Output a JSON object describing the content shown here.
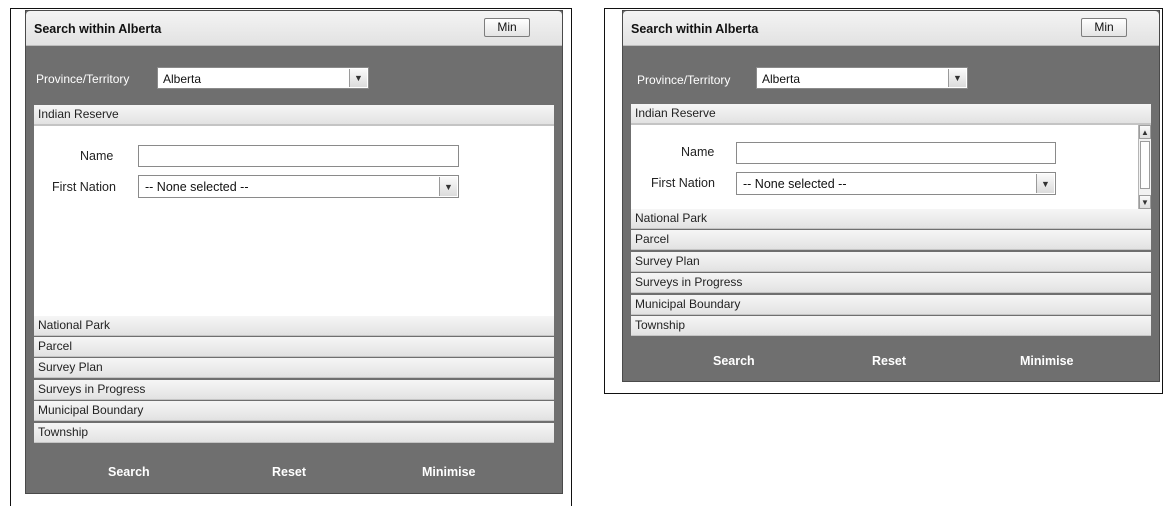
{
  "expanded_view": {
    "title": "Search within Alberta",
    "min_label": "Min",
    "province_label": "Province/Territory",
    "province_value": "Alberta",
    "sections": {
      "indian_reserve": "Indian Reserve",
      "national_park": "National Park",
      "parcel": "Parcel",
      "survey_plan": "Survey Plan",
      "surveys_in_progress": "Surveys in Progress",
      "municipal_boundary": "Municipal Boundary",
      "township": "Township"
    },
    "name_label": "Name",
    "name_value": "",
    "first_nation_label": "First Nation",
    "first_nation_value": "-- None selected --",
    "buttons": {
      "search": "Search",
      "reset": "Reset",
      "minimise": "Minimise"
    }
  },
  "compact_view": {
    "title": "Search within Alberta",
    "min_label": "Min",
    "province_label": "Province/Territory",
    "province_value": "Alberta",
    "sections": {
      "indian_reserve": "Indian Reserve",
      "national_park": "National Park",
      "parcel": "Parcel",
      "survey_plan": "Survey Plan",
      "surveys_in_progress": "Surveys in Progress",
      "municipal_boundary": "Municipal Boundary",
      "township": "Township"
    },
    "name_label": "Name",
    "name_value": "",
    "first_nation_label": "First Nation",
    "first_nation_value": "-- None selected --",
    "buttons": {
      "search": "Search",
      "reset": "Reset",
      "minimise": "Minimise"
    }
  },
  "icons": {
    "dropdown": "chevron-down-icon",
    "scroll_up": "arrow-up-icon",
    "scroll_down": "arrow-down-icon"
  }
}
